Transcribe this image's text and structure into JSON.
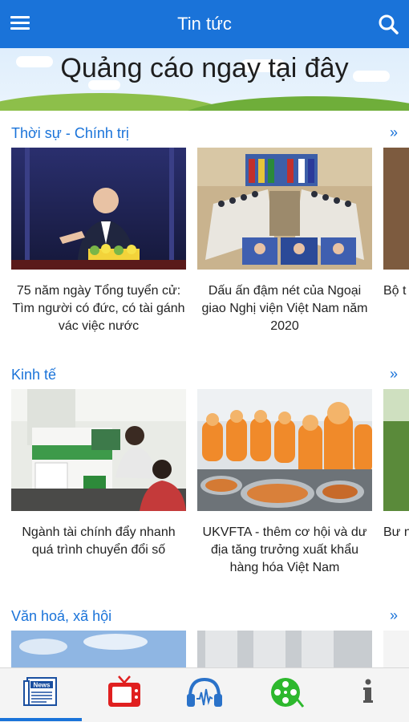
{
  "header": {
    "title": "Tin tức"
  },
  "ad": {
    "text": "Quảng cáo ngay tại đây"
  },
  "sections": [
    {
      "title": "Thời sự - Chính trị",
      "more": "»",
      "articles": [
        {
          "caption": "75 năm ngày Tổng tuyển cử: Tìm người có đức, có tài gánh vác việc nước"
        },
        {
          "caption": "Dấu ấn đậm nét của Ngoại giao Nghị viện Việt Nam năm 2020"
        },
        {
          "caption": "Bộ t Ni nh"
        }
      ]
    },
    {
      "title": "Kinh tế",
      "more": "»",
      "articles": [
        {
          "caption": "Ngành tài chính đẩy nhanh quá trình chuyển đổi số"
        },
        {
          "caption": "UKVFTA - thêm cơ hội và dư địa tăng trưởng xuất khẩu hàng hóa Việt Nam"
        },
        {
          "caption": "Bư nôn"
        }
      ]
    },
    {
      "title": "Văn hoá, xã hội",
      "more": "»"
    }
  ],
  "tabbar": {
    "news_icon_label": "News",
    "items": [
      "news-icon",
      "tv-icon",
      "headphones-icon",
      "film-reel-icon",
      "info-icon"
    ],
    "accent": "#1a73d9"
  },
  "colors": {
    "primary": "#1a73d9",
    "tv": "#e02020",
    "film": "#2db82d"
  }
}
